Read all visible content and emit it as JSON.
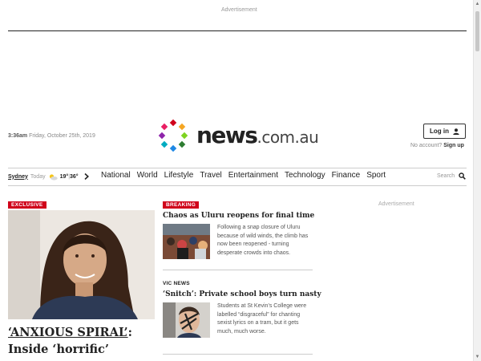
{
  "ads": {
    "top_label": "Advertisement",
    "side_label": "Advertisement"
  },
  "header": {
    "time": "3:36am",
    "date": "Friday, October 25th, 2019",
    "logo_main": "news",
    "logo_tld": ".com.au",
    "login_label": "Log in",
    "no_account_text": "No account?",
    "signup_label": "Sign up"
  },
  "weather": {
    "city": "Sydney",
    "day": "Today",
    "low": "19°",
    "separator": "|",
    "high": "36°"
  },
  "nav": {
    "items": [
      "National",
      "World",
      "Lifestyle",
      "Travel",
      "Entertainment",
      "Technology",
      "Finance",
      "Sport"
    ],
    "search_label": "Search"
  },
  "hero": {
    "tag": "EXCLUSIVE",
    "title_quoted": "‘ANXIOUS SPIRAL’",
    "title_rest": ": Inside ‘horrific’"
  },
  "stories": [
    {
      "label": "BREAKING",
      "title": "Chaos as Uluru reopens for final time",
      "desc": "Following a snap closure of Uluru because of wild winds, the climb has now been reopened - turning desperate crowds into chaos."
    },
    {
      "label": "VIC NEWS",
      "title": "‘Snitch’: Private school boys turn nasty",
      "desc": "Students at St Kevin’s College were labelled “disgraceful” for chanting sexist lyrics on a tram, but it gets much, much worse."
    }
  ],
  "colors": {
    "accent": "#d0021b",
    "text": "#222222"
  },
  "icons": {
    "login": "user-icon",
    "search": "search-icon",
    "weather": "sun-cloud-icon",
    "nav_more": "chevron-right-icon"
  }
}
